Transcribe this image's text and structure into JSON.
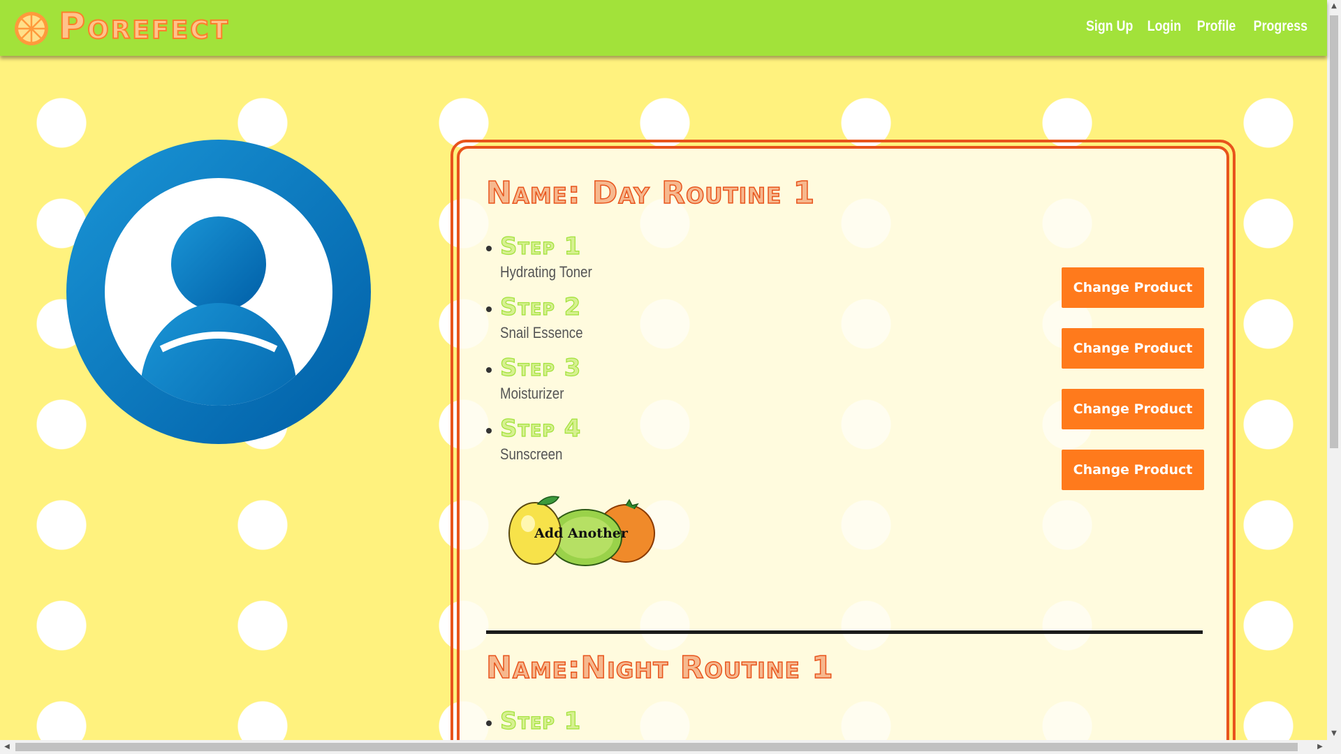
{
  "app": {
    "brand_name": "Porefect",
    "brand_icon": "orange-slice-icon"
  },
  "nav": {
    "links": [
      "Sign Up",
      "Login",
      "Profile",
      "Progress"
    ]
  },
  "avatar": {
    "icon": "user-profile-icon",
    "color": "#0073b8"
  },
  "routines": [
    {
      "title": "Name: Day Routine 1",
      "steps": [
        {
          "label": "Step 1",
          "product": "Hydrating Toner"
        },
        {
          "label": "Step 2",
          "product": "Snail Essence"
        },
        {
          "label": "Step 3",
          "product": "Moisturizer"
        },
        {
          "label": "Step 4",
          "product": "Sunscreen"
        }
      ]
    },
    {
      "title": "Name:Night Routine 1",
      "steps": [
        {
          "label": "Step 1",
          "product": ""
        }
      ]
    }
  ],
  "buttons": {
    "change_product": "Change Product",
    "add_another": "Add Another"
  },
  "colors": {
    "navbar": "#a2e23a",
    "background": "#fff27e",
    "accent_orange": "#ff7a1c",
    "card_border": "#e8541c",
    "step_green": "#a2e23a"
  }
}
